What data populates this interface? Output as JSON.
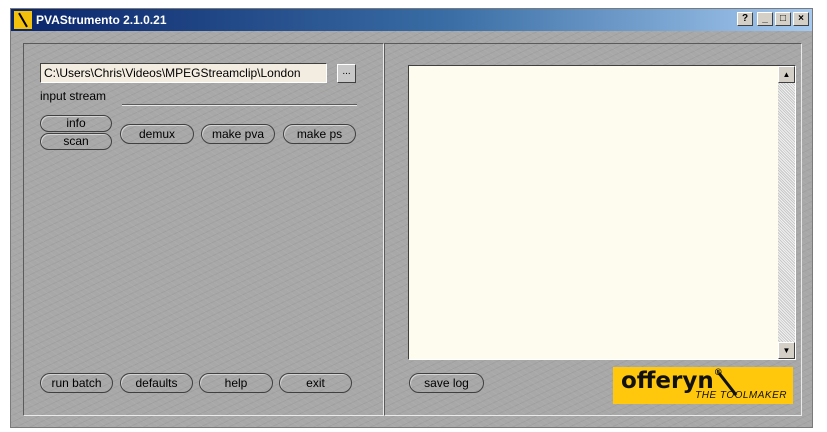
{
  "window": {
    "title": "PVAStrumento 2.1.0.21",
    "controls": {
      "help": "?",
      "minimize": "_",
      "maximize": "□",
      "close": "×"
    }
  },
  "left_panel": {
    "input_path": "C:\\Users\\Chris\\Videos\\MPEGStreamclip\\London",
    "browse_label": "...",
    "input_label": "input stream",
    "buttons": {
      "info": "info",
      "scan": "scan",
      "demux": "demux",
      "make_pva": "make pva",
      "make_ps": "make ps",
      "run_batch": "run batch",
      "defaults": "defaults",
      "help": "help",
      "exit": "exit"
    }
  },
  "right_panel": {
    "log_text": "",
    "save_log": "save log",
    "scroll_up": "▲",
    "scroll_down": "▼",
    "logo": {
      "word": "offeryn",
      "reg": "®",
      "tagline": "THE TOOLMAKER"
    }
  },
  "colors": {
    "panel_bg": "#a8a8a8",
    "log_bg": "#fefcee",
    "logo_bg": "#ffc80c",
    "titlebar": "#0a246a"
  }
}
